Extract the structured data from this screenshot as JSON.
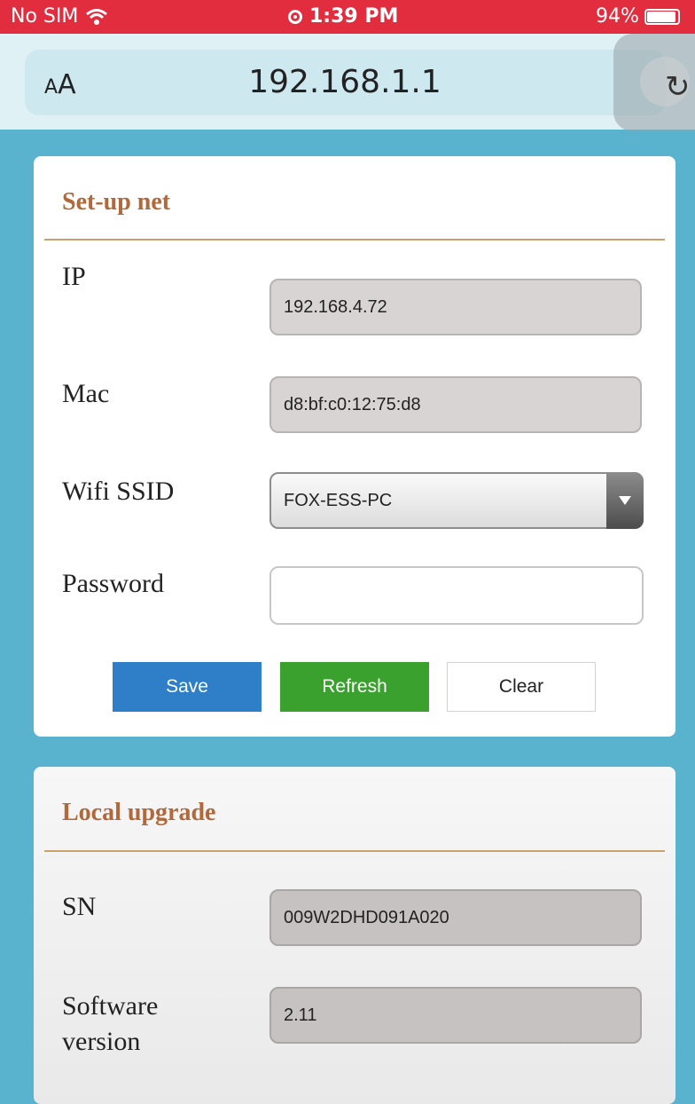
{
  "status_bar": {
    "carrier": "No SIM",
    "time": "1:39 PM",
    "battery": "94%",
    "battery_level": 0.94
  },
  "browser": {
    "text_size_label_small": "A",
    "text_size_label_large": "A",
    "url": "192.168.1.1",
    "reload_icon": "reload-icon"
  },
  "setup_net": {
    "title": "Set-up net",
    "ip_label": "IP",
    "ip_value": "192.168.4.72",
    "mac_label": "Mac",
    "mac_value": "d8:bf:c0:12:75:d8",
    "ssid_label": "Wifi SSID",
    "ssid_value": "FOX-ESS-PC",
    "password_label": "Password",
    "password_value": "",
    "save_label": "Save",
    "refresh_label": "Refresh",
    "clear_label": "Clear"
  },
  "local_upgrade": {
    "title": "Local upgrade",
    "sn_label": "SN",
    "sn_value": "009W2DHD091A020",
    "software_label_line1": "Software",
    "software_label_line2": "version",
    "software_value": "2.11"
  },
  "colors": {
    "status_bar": "#e22d3f",
    "page_background": "#59b3cf",
    "section_title": "#b1683a",
    "save_button": "#2f7fc8",
    "refresh_button": "#3aa02e"
  }
}
